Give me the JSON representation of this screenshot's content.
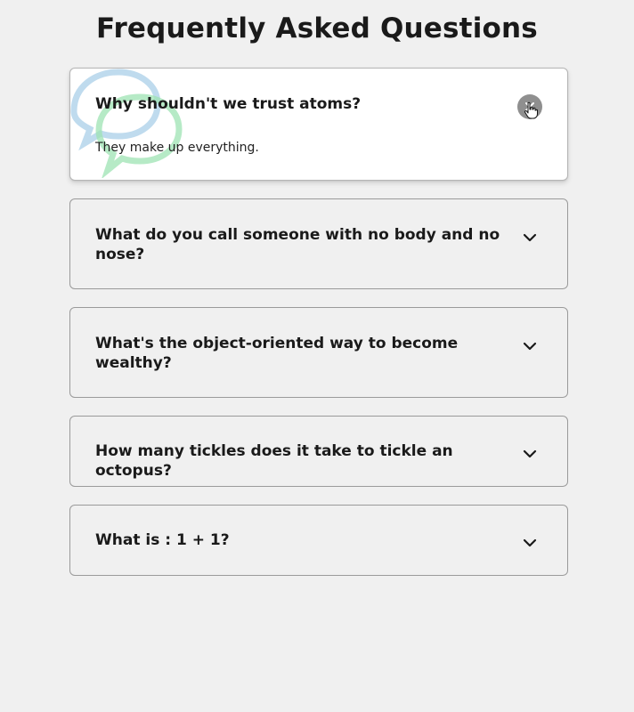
{
  "page": {
    "title": "Frequently Asked Questions"
  },
  "faq": [
    {
      "question": "Why shouldn't we trust atoms?",
      "answer": "They make up everything.",
      "expanded": true
    },
    {
      "question": "What do you call someone with no body and no nose?",
      "answer": "",
      "expanded": false
    },
    {
      "question": "What's the object-oriented way to become wealthy?",
      "answer": "",
      "expanded": false
    },
    {
      "question": "How many tickles does it take to tickle an octopus?",
      "answer": "",
      "expanded": false
    },
    {
      "question": "What is : 1 + 1?",
      "answer": "",
      "expanded": false
    }
  ],
  "icons": {
    "collapse": "close-icon",
    "expand": "chevron-down-icon",
    "decoration": "chat-bubbles-icon"
  },
  "colors": {
    "background": "#f0f0f0",
    "active_card": "#ffffff",
    "toggle_active": "#8f8f8f",
    "bubble_blue": "#a9cfe8",
    "bubble_green": "#9ee3b3"
  }
}
